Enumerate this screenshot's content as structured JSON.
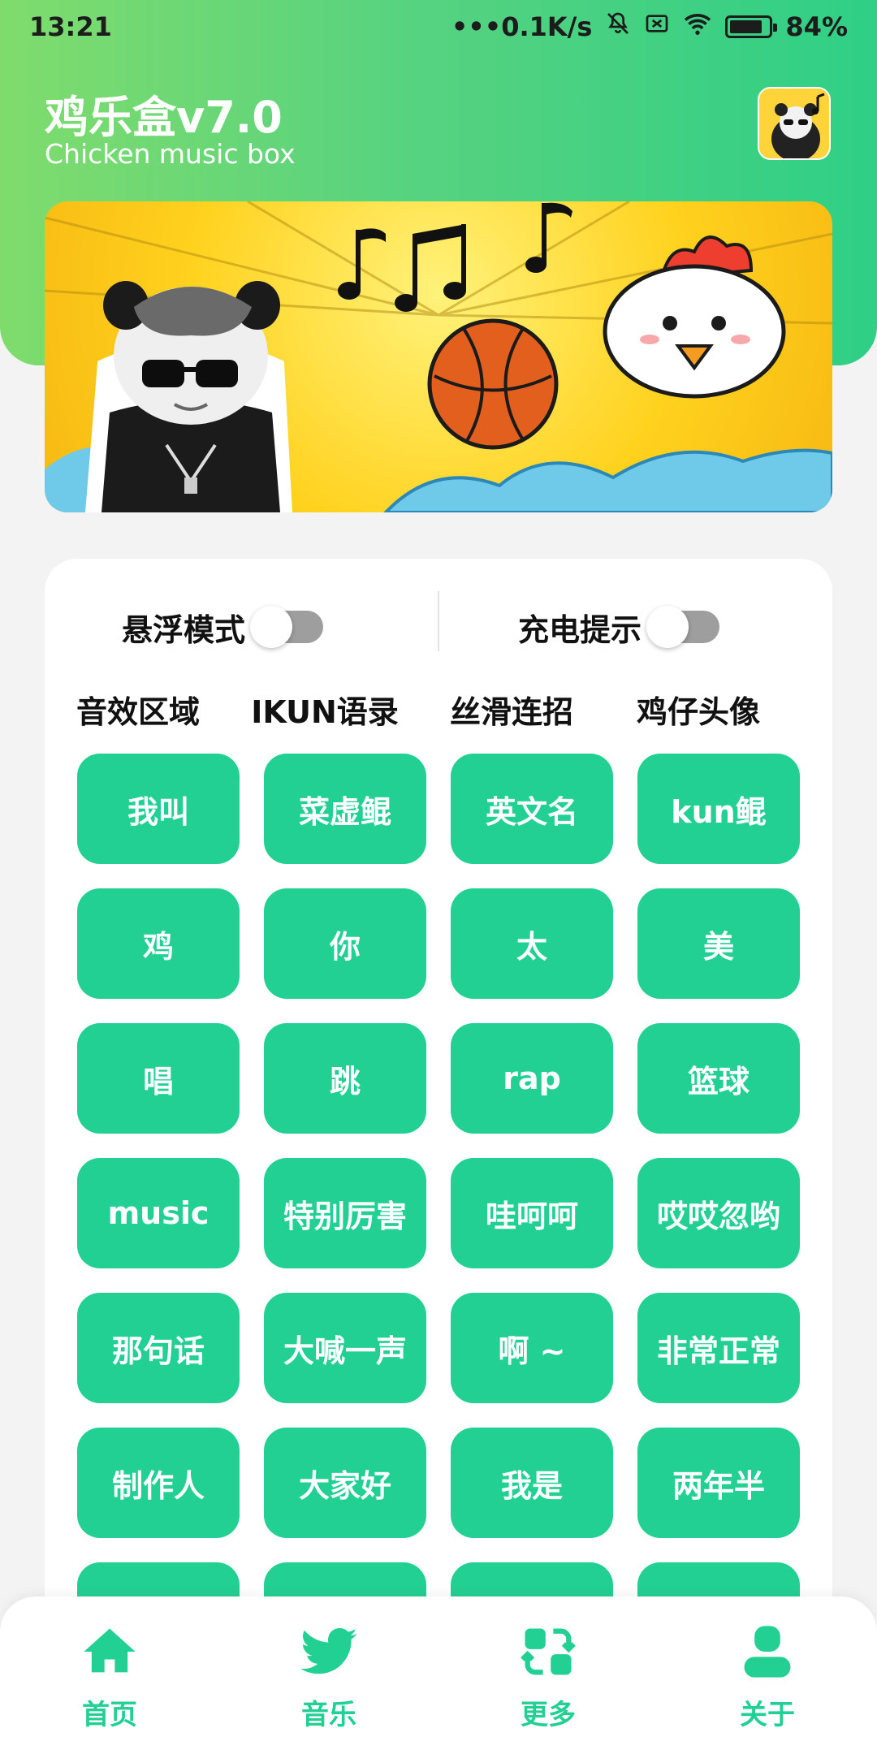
{
  "status_bar": {
    "time": "13:21",
    "network_speed": "•••0.1K/s",
    "battery": "84%",
    "battery_level": 0.84
  },
  "header": {
    "title": "鸡乐盒v7.0",
    "subtitle": "Chicken music box"
  },
  "settings": {
    "float_mode_label": "悬浮模式",
    "float_mode_on": false,
    "charge_tip_label": "充电提示",
    "charge_tip_on": false
  },
  "tabs": [
    "音效区域",
    "IKUN语录",
    "丝滑连招",
    "鸡仔头像"
  ],
  "sound_buttons": [
    "我叫",
    "菜虚鲲",
    "英文名",
    "kun鲲",
    "鸡",
    "你",
    "太",
    "美",
    "唱",
    "跳",
    "rap",
    "篮球",
    "music",
    "特别厉害",
    "哇呵呵",
    "哎哎忽哟",
    "那句话",
    "大喊一声",
    "啊 ~",
    "非常正常",
    "制作人",
    "大家好",
    "我是",
    "两年半"
  ],
  "bottom_nav": [
    {
      "label": "首页",
      "icon": "home-icon"
    },
    {
      "label": "音乐",
      "icon": "bird-icon"
    },
    {
      "label": "更多",
      "icon": "swap-icon"
    },
    {
      "label": "关于",
      "icon": "user-icon"
    }
  ],
  "colors": {
    "accent": "#23d094",
    "header_start": "#7fdc6c",
    "header_end": "#2fcf86"
  }
}
